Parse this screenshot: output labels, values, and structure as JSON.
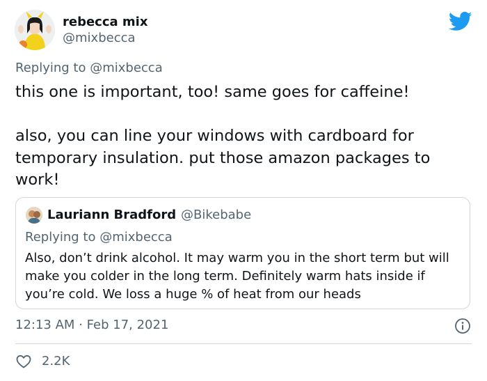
{
  "tweet": {
    "author": {
      "name": "rebecca mix",
      "handle": "@mixbecca"
    },
    "replying_prefix": "Replying to",
    "replying_handle": "@mixbecca",
    "text_paragraphs": [
      "this one is important, too! same goes for caffeine!",
      "also, you can line your windows with cardboard for temporary insulation. put those amazon packages to work!"
    ],
    "time": "12:13 AM",
    "separator": "·",
    "date": "Feb 17, 2021",
    "likes": "2.2K"
  },
  "quote": {
    "author": {
      "name": "Lauriann Bradford",
      "handle": "@Bikebabe"
    },
    "replying_prefix": "Replying to",
    "replying_handle": "@mixbecca",
    "text": "Also, don’t drink alcohol. It may warm you in the short term but will make you colder in the long term. Definitely warm hats inside if you’re cold. We loss a huge % of heat from our heads"
  },
  "icons": {
    "brand": "twitter-bird-icon",
    "info": "info-icon",
    "like": "heart-icon"
  },
  "colors": {
    "brand": "#1d9bf0",
    "text": "#0f1419",
    "secondary": "#536471",
    "border": "#cfd9de"
  }
}
